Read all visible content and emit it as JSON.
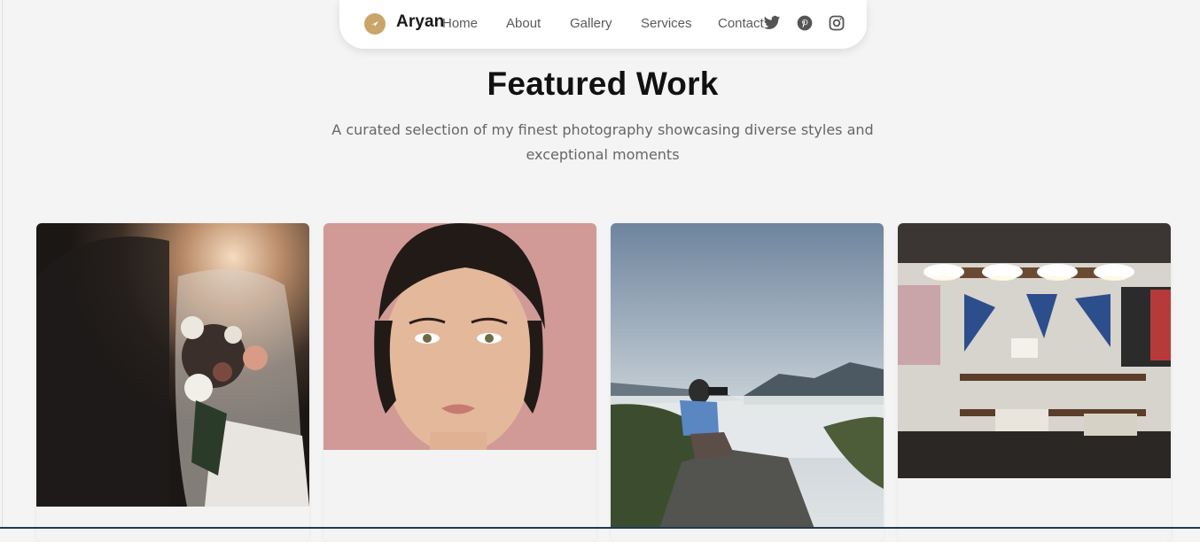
{
  "nav": {
    "brand": "Aryan",
    "links": [
      {
        "label": "Home"
      },
      {
        "label": "About"
      },
      {
        "label": "Gallery"
      },
      {
        "label": "Services"
      },
      {
        "label": "Contact"
      }
    ],
    "social": [
      "twitter-icon",
      "pinterest-icon",
      "instagram-icon"
    ],
    "accent_color": "#c9a56a"
  },
  "hero": {
    "title": "Featured Work",
    "subtitle": "A curated selection of my finest photography showcasing diverse styles and exceptional moments"
  },
  "gallery": {
    "items": [
      {
        "subject": "wedding-couple-bouquet-photo"
      },
      {
        "subject": "woman-portrait-pink-background-photo"
      },
      {
        "subject": "photographer-on-mountain-rock-photo"
      },
      {
        "subject": "clothing-store-interior-photo"
      }
    ]
  }
}
